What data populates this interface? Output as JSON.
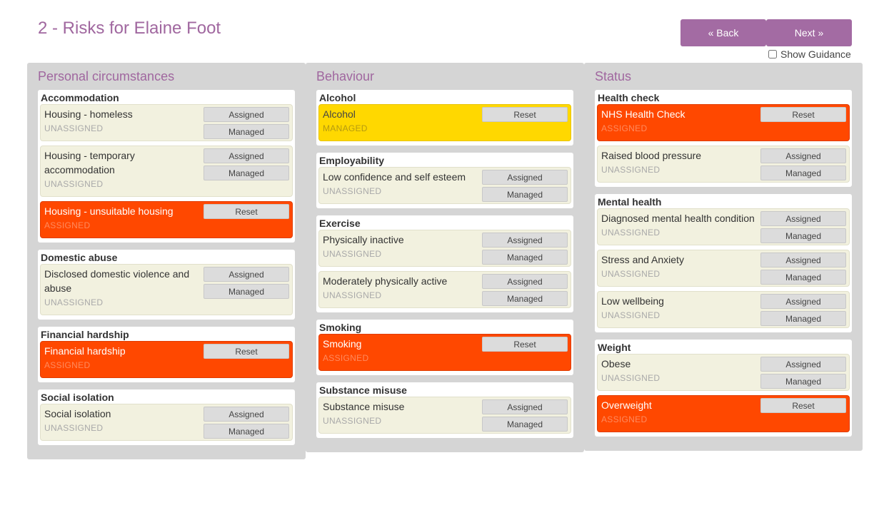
{
  "page_title": "2 - Risks for Elaine Foot",
  "nav": {
    "back_label": "« Back",
    "next_label": "Next »",
    "guidance_label": "Show Guidance"
  },
  "labels": {
    "assigned": "Assigned",
    "managed": "Managed",
    "reset": "Reset"
  },
  "colors": {
    "accent": "#a36ba3",
    "assigned": "#ff4800",
    "managed": "#ffd800",
    "unassigned": "#f2f1df"
  },
  "columns": [
    {
      "title": "Personal circumstances",
      "groups": [
        {
          "title": "Accommodation",
          "risks": [
            {
              "name": "Housing - homeless",
              "status": "UNASSIGNED"
            },
            {
              "name": "Housing - temporary accommodation",
              "status": "UNASSIGNED"
            },
            {
              "name": "Housing - unsuitable housing",
              "status": "ASSIGNED"
            }
          ]
        },
        {
          "title": "Domestic abuse",
          "risks": [
            {
              "name": "Disclosed domestic violence and abuse",
              "status": "UNASSIGNED"
            }
          ]
        },
        {
          "title": "Financial hardship",
          "risks": [
            {
              "name": "Financial hardship",
              "status": "ASSIGNED"
            }
          ]
        },
        {
          "title": "Social isolation",
          "risks": [
            {
              "name": "Social isolation",
              "status": "UNASSIGNED"
            }
          ]
        }
      ]
    },
    {
      "title": "Behaviour",
      "groups": [
        {
          "title": "Alcohol",
          "risks": [
            {
              "name": "Alcohol",
              "status": "MANAGED"
            }
          ]
        },
        {
          "title": "Employability",
          "risks": [
            {
              "name": "Low confidence and self esteem",
              "status": "UNASSIGNED"
            }
          ]
        },
        {
          "title": "Exercise",
          "risks": [
            {
              "name": "Physically inactive",
              "status": "UNASSIGNED"
            },
            {
              "name": "Moderately physically active",
              "status": "UNASSIGNED"
            }
          ]
        },
        {
          "title": "Smoking",
          "risks": [
            {
              "name": "Smoking",
              "status": "ASSIGNED"
            }
          ]
        },
        {
          "title": "Substance misuse",
          "risks": [
            {
              "name": "Substance misuse",
              "status": "UNASSIGNED"
            }
          ]
        }
      ]
    },
    {
      "title": "Status",
      "groups": [
        {
          "title": "Health check",
          "risks": [
            {
              "name": "NHS Health Check",
              "status": "ASSIGNED"
            },
            {
              "name": "Raised blood pressure",
              "status": "UNASSIGNED"
            }
          ]
        },
        {
          "title": "Mental health",
          "risks": [
            {
              "name": "Diagnosed mental health condition",
              "status": "UNASSIGNED"
            },
            {
              "name": "Stress and Anxiety",
              "status": "UNASSIGNED"
            },
            {
              "name": "Low wellbeing",
              "status": "UNASSIGNED"
            }
          ]
        },
        {
          "title": "Weight",
          "risks": [
            {
              "name": "Obese",
              "status": "UNASSIGNED"
            },
            {
              "name": "Overweight",
              "status": "ASSIGNED"
            }
          ]
        }
      ]
    }
  ]
}
